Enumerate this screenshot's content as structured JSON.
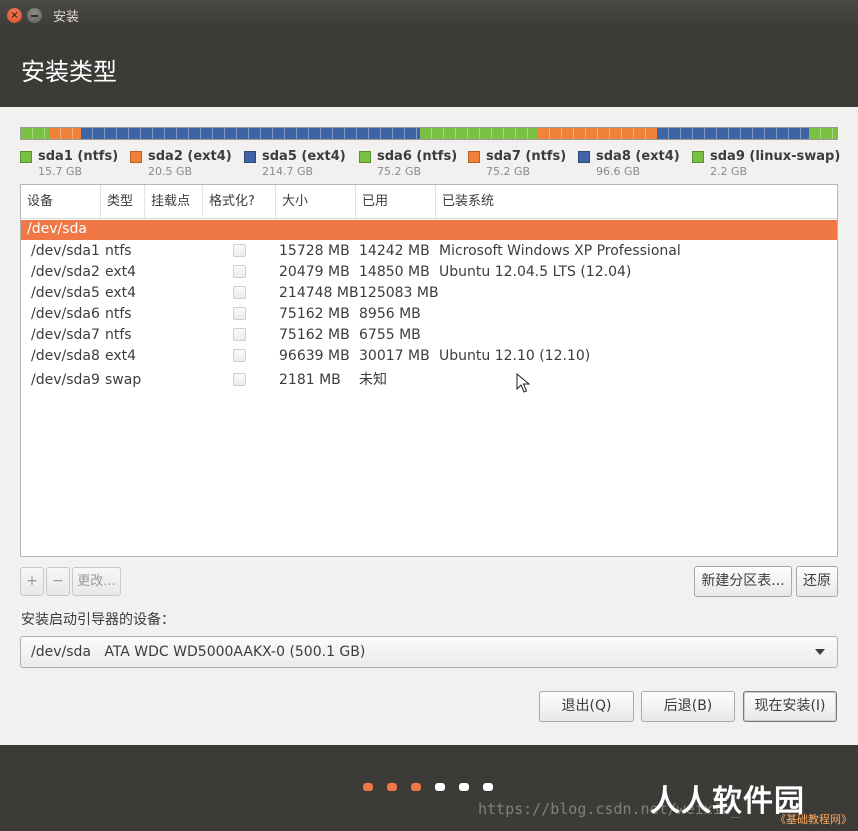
{
  "window": {
    "title": "安装"
  },
  "header": {
    "title": "安装类型"
  },
  "colors": {
    "ntfs": "#8ac43f",
    "ext4": "#3e64a6",
    "ntfs_orange": "#f0823a",
    "swap": "#8ac43f",
    "selected_row": "#f07746",
    "dot_active": "#f07746",
    "dot_inactive": "#ffffff"
  },
  "partitions_bar": [
    {
      "name": "sda1",
      "fs": "ntfs",
      "color": "#7ac143",
      "weight": 15.7
    },
    {
      "name": "sda2",
      "fs": "ext4",
      "color": "#f0823a",
      "weight": 20.5
    },
    {
      "name": "sda5",
      "fs": "ext4",
      "color": "#3e64a6",
      "weight": 214.7
    },
    {
      "name": "sda6",
      "fs": "ntfs",
      "color": "#7ac143",
      "weight": 75.2
    },
    {
      "name": "sda7",
      "fs": "ntfs",
      "color": "#f0823a",
      "weight": 75.2
    },
    {
      "name": "sda8",
      "fs": "ext4",
      "color": "#3e64a6",
      "weight": 96.6
    },
    {
      "name": "sda9",
      "fs": "linux-swap",
      "color": "#7ac143",
      "weight": 2.2
    }
  ],
  "legend": [
    {
      "label": "sda1 (ntfs)",
      "size": "15.7 GB",
      "color": "#7ac143"
    },
    {
      "label": "sda2 (ext4)",
      "size": "20.5 GB",
      "color": "#f0823a"
    },
    {
      "label": "sda5 (ext4)",
      "size": "214.7 GB",
      "color": "#3e64a6"
    },
    {
      "label": "sda6 (ntfs)",
      "size": "75.2 GB",
      "color": "#7ac143"
    },
    {
      "label": "sda7 (ntfs)",
      "size": "75.2 GB",
      "color": "#f0823a"
    },
    {
      "label": "sda8 (ext4)",
      "size": "96.6 GB",
      "color": "#3e64a6"
    },
    {
      "label": "sda9 (linux-swap)",
      "size": "2.2 GB",
      "color": "#7ac143"
    }
  ],
  "table": {
    "columns": [
      "设备",
      "类型",
      "挂载点",
      "格式化?",
      "大小",
      "已用",
      "已装系统"
    ],
    "selected_device": "/dev/sda",
    "rows": [
      {
        "device": "/dev/sda1",
        "type": "ntfs",
        "mount": "",
        "size": "15728 MB",
        "used": "14242 MB",
        "system": "Microsoft Windows XP Professional"
      },
      {
        "device": "/dev/sda2",
        "type": "ext4",
        "mount": "",
        "size": "20479 MB",
        "used": "14850 MB",
        "system": "Ubuntu 12.04.5 LTS (12.04)"
      },
      {
        "device": "/dev/sda5",
        "type": "ext4",
        "mount": "",
        "size": "214748 MB",
        "used": "125083 MB",
        "system": ""
      },
      {
        "device": "/dev/sda6",
        "type": "ntfs",
        "mount": "",
        "size": "75162 MB",
        "used": "8956 MB",
        "system": ""
      },
      {
        "device": "/dev/sda7",
        "type": "ntfs",
        "mount": "",
        "size": "75162 MB",
        "used": "6755 MB",
        "system": ""
      },
      {
        "device": "/dev/sda8",
        "type": "ext4",
        "mount": "",
        "size": "96639 MB",
        "used": "30017 MB",
        "system": "Ubuntu 12.10 (12.10)"
      },
      {
        "device": "/dev/sda9",
        "type": "swap",
        "mount": "",
        "size": "2181 MB",
        "used": "未知",
        "system": ""
      }
    ]
  },
  "toolbar": {
    "add": "+",
    "remove": "−",
    "change": "更改...",
    "new_table": "新建分区表...",
    "revert": "还原"
  },
  "bootloader": {
    "label": "安装启动引导器的设备：",
    "value": "/dev/sda   ATA WDC WD5000AAKX-0 (500.1 GB)"
  },
  "actions": {
    "quit": "退出(Q)",
    "back": "后退(B)",
    "install": "现在安装(I)"
  },
  "progress": {
    "total_steps": 6,
    "active_steps": 3
  },
  "watermark": {
    "url": "https://blog.csdn.net/weixin_",
    "logo": "人人软件园",
    "logo_sub": "《基础教程网》"
  }
}
